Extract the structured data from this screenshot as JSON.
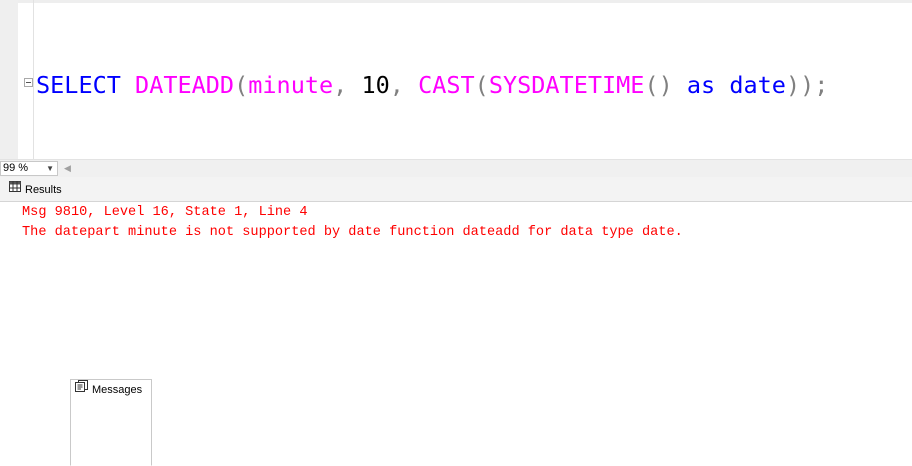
{
  "editor": {
    "tokens": {
      "select": "SELECT",
      "dateadd": "DATEADD",
      "open1": "(",
      "minute": "minute",
      "comma1": ",",
      "ten": "10",
      "comma2": ",",
      "cast": "CAST",
      "open2": "(",
      "sysdatetime": "SYSDATETIME",
      "parens": "()",
      "as": "as",
      "date": "date",
      "close": "));"
    }
  },
  "statusbar": {
    "zoom_value": "99 %"
  },
  "result_tabs": [
    {
      "label": "Results",
      "icon": "grid-icon",
      "selected": false
    },
    {
      "label": "Messages",
      "icon": "messages-icon",
      "selected": true
    }
  ],
  "messages": [
    "Msg 9810, Level 16, State 1, Line 4",
    "The datepart minute is not supported by date function dateadd for data type date."
  ],
  "colors": {
    "keyword": "#0000ff",
    "function": "#ff00ff",
    "punctuation": "#808080",
    "error_text": "#ff0000"
  }
}
